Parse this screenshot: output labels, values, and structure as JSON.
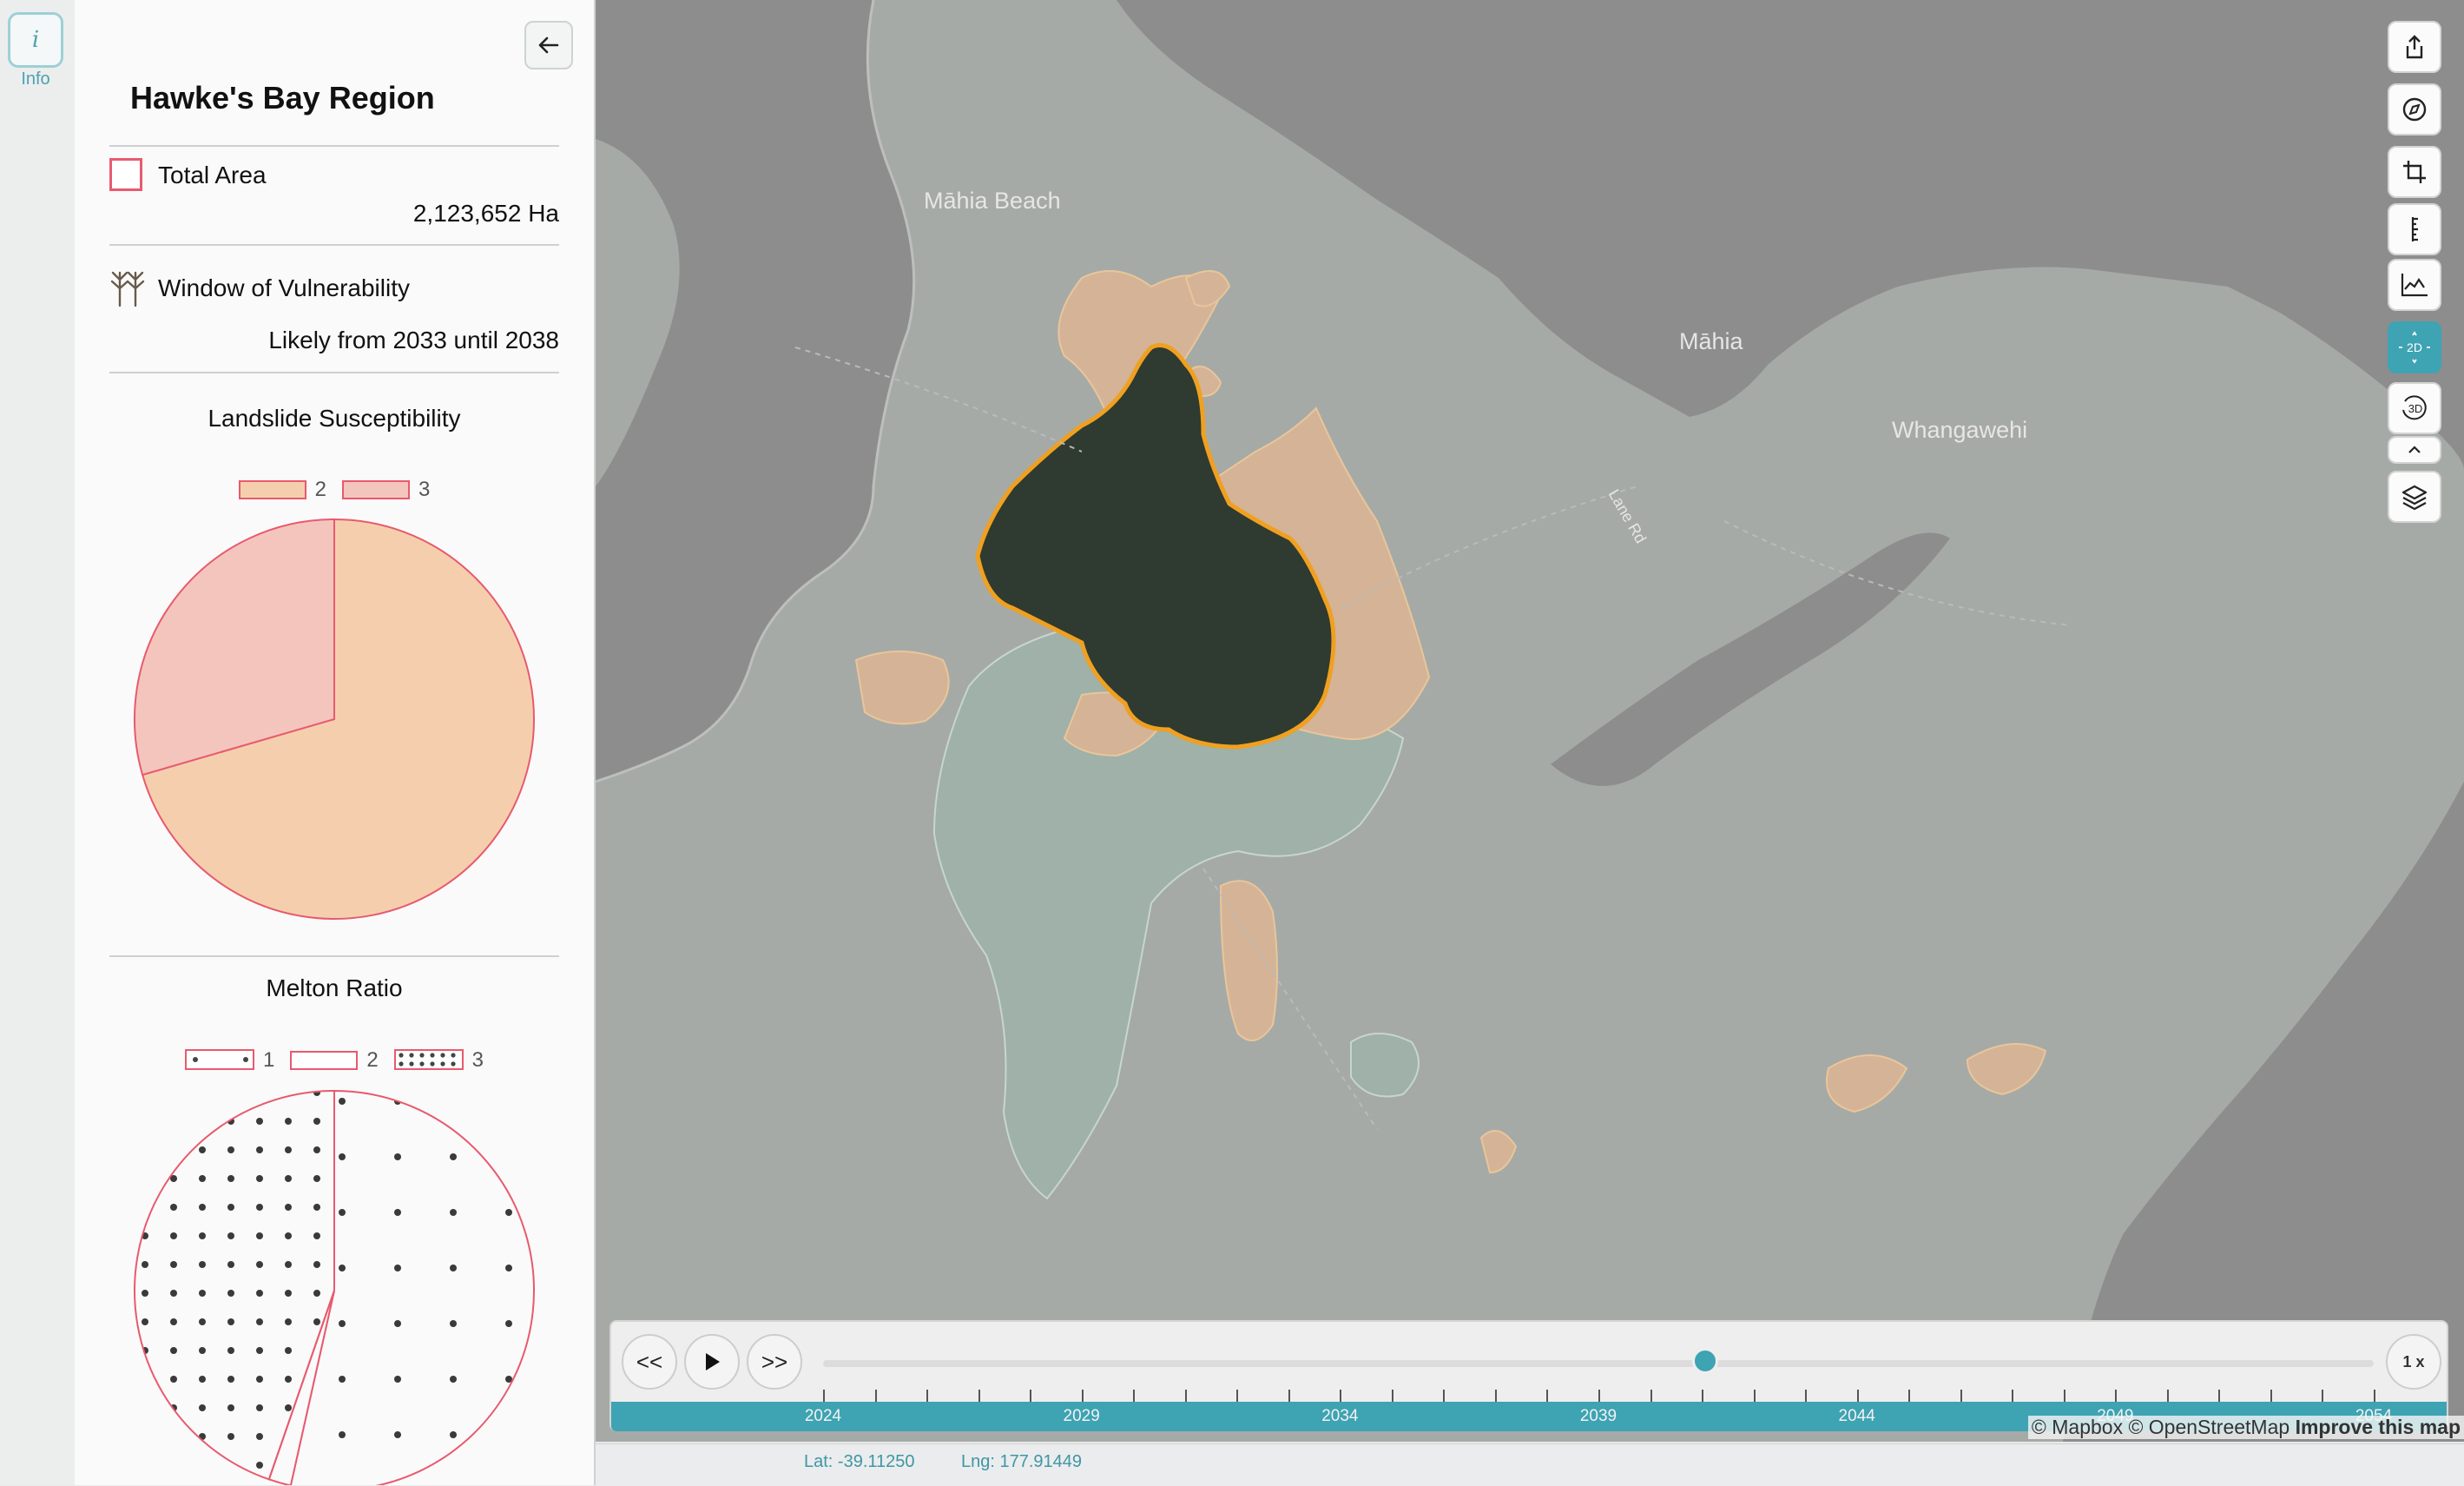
{
  "rail": {
    "info_icon": "i",
    "info_label": "Info"
  },
  "panel": {
    "back_icon": "arrow-left-icon",
    "title": "Hawke's Bay Region",
    "total_area": {
      "label": "Total Area",
      "value": "2,123,652 Ha"
    },
    "window_of_vulnerability": {
      "icon": "forest-icon",
      "label": "Window of Vulnerability",
      "value": "Likely from 2033 until 2038"
    },
    "accent_color": "#e85a6e"
  },
  "chart_data": [
    {
      "type": "pie",
      "title": "Landslide Susceptibility",
      "legend": [
        {
          "label": "2",
          "color": "#f5cfad"
        },
        {
          "label": "3",
          "color": "#f4c5bd"
        }
      ],
      "slices": [
        {
          "label": "2",
          "value": 70.5,
          "color": "#f5cfad"
        },
        {
          "label": "3",
          "value": 29.5,
          "color": "#f4c5bd"
        }
      ]
    },
    {
      "type": "pie",
      "title": "Melton Ratio",
      "legend": [
        {
          "label": "1",
          "pattern": "sparse-dots"
        },
        {
          "label": "2",
          "pattern": "none"
        },
        {
          "label": "3",
          "pattern": "dense-dots"
        }
      ],
      "slices": [
        {
          "label": "1",
          "value": 53.5,
          "pattern": "sparse-dots"
        },
        {
          "label": "2",
          "value": 1.8,
          "pattern": "none"
        },
        {
          "label": "3",
          "value": 44.7,
          "pattern": "dense-dots"
        }
      ]
    }
  ],
  "map": {
    "labels": [
      "Māhia Beach",
      "Māhia",
      "Whangawehi",
      "Lane Rd"
    ],
    "highlight_color": "#2f3a30",
    "outline_color": "#f0a020"
  },
  "toolbar": [
    "share-icon",
    "compass-icon",
    "crop-icon",
    "ruler-icon",
    "elevation-profile-icon",
    "2d-view-icon",
    "3d-rotate-icon",
    "chevron-up-icon",
    "layers-icon"
  ],
  "toolbar_labels": {
    "2d": "2D",
    "3d": "3D"
  },
  "timeline": {
    "rewind_label": "<<",
    "forward_label": ">>",
    "speed_label": "1 x",
    "years": [
      "2024",
      "2029",
      "2034",
      "2039",
      "2044",
      "2049",
      "2054"
    ],
    "current_position": 0.569
  },
  "attribution": {
    "text": "© Mapbox © OpenStreetMap",
    "link": "Improve this map"
  },
  "status": {
    "lat": "Lat: -39.11250",
    "lng": "Lng: 177.91449"
  }
}
